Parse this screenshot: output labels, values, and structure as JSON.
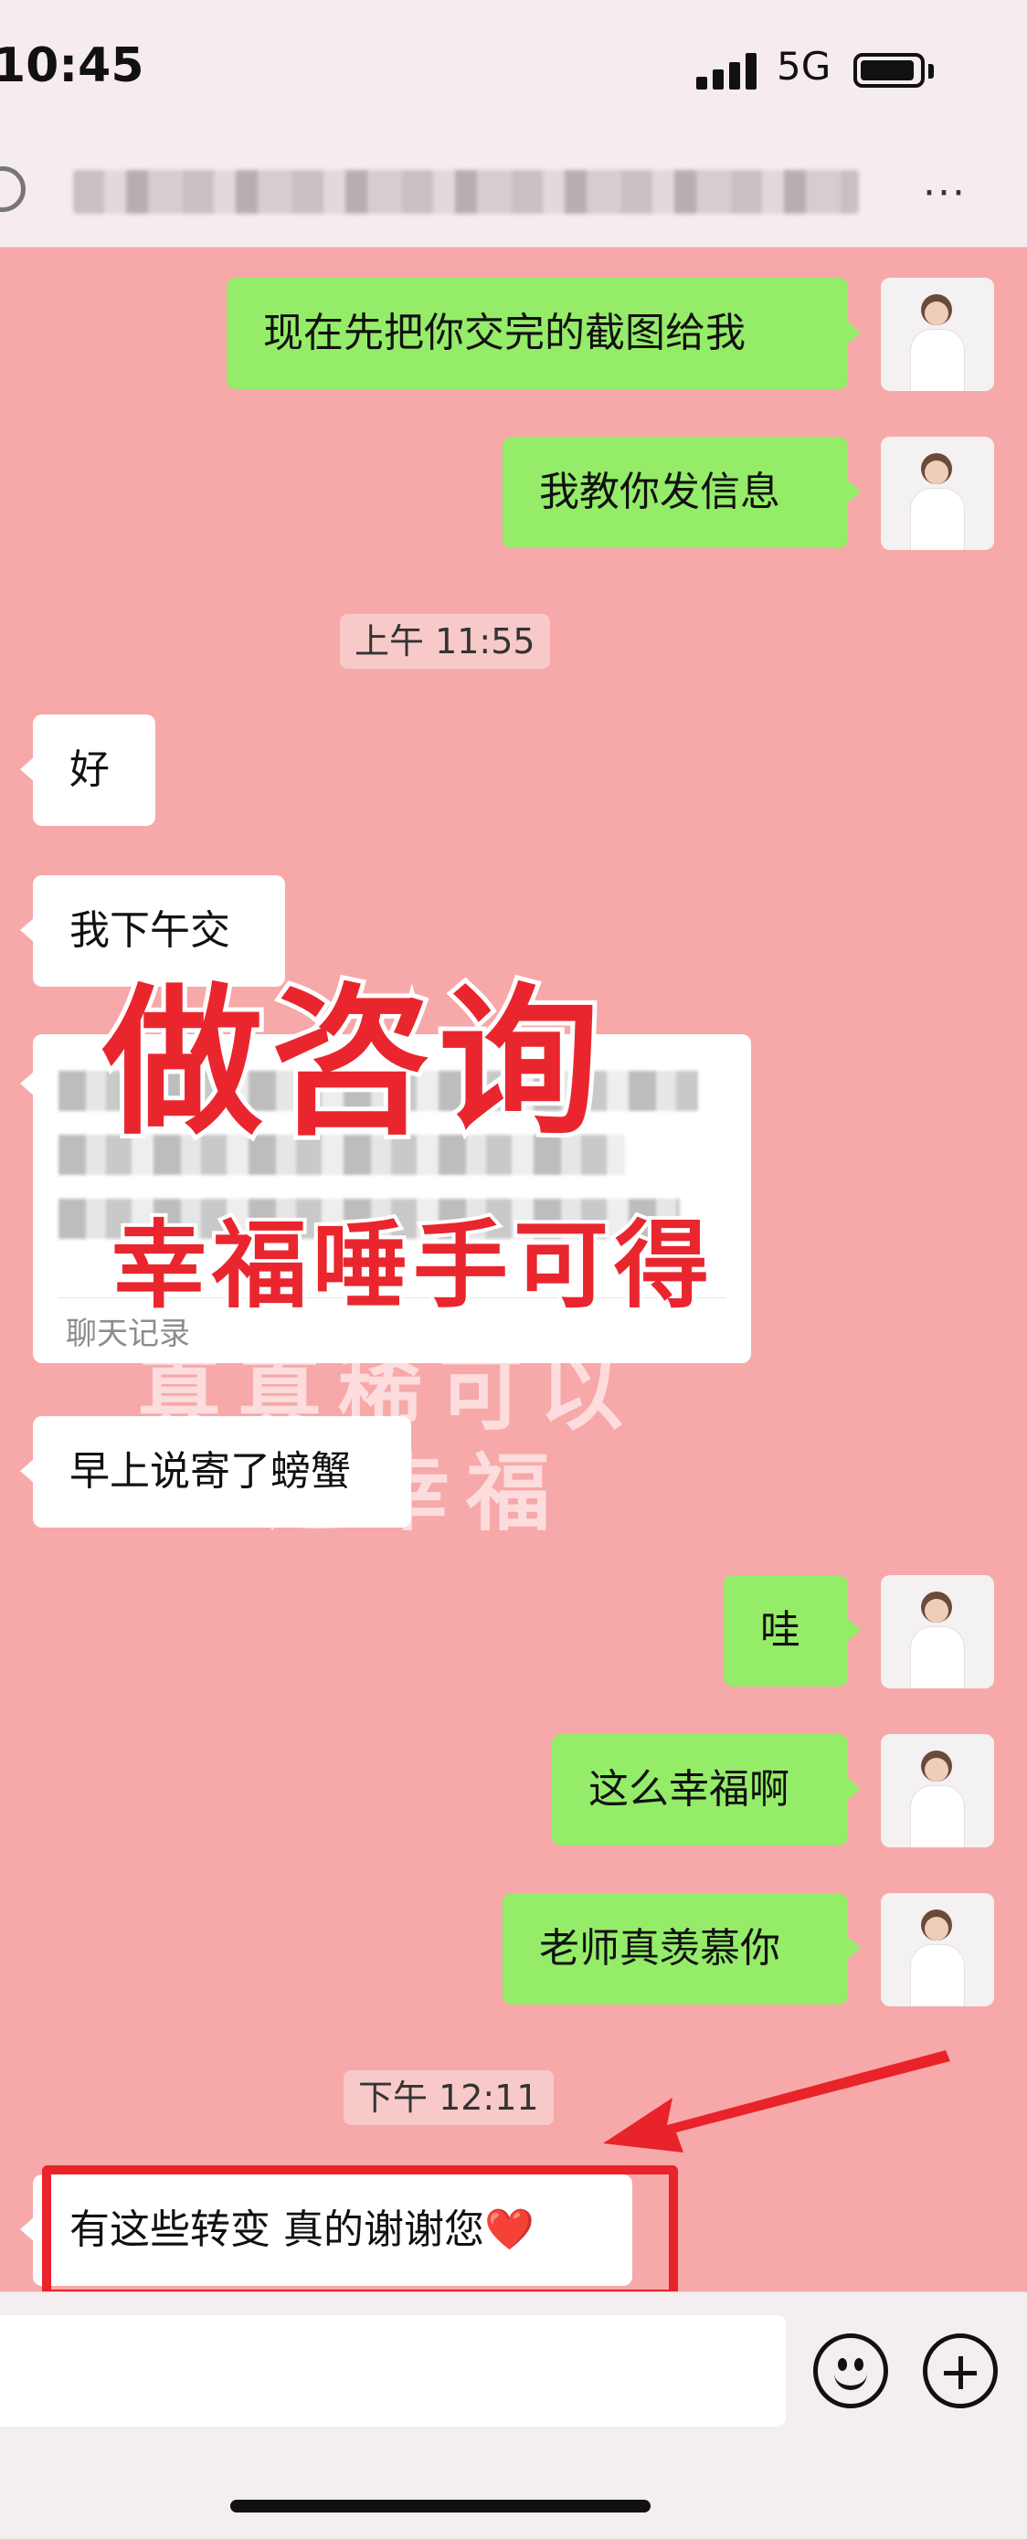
{
  "status_bar": {
    "time": "10:45",
    "network": "5G"
  },
  "nav": {
    "back_icon": "back-circle-icon",
    "more_icon": "more-dots-icon",
    "more_label": "···"
  },
  "messages": {
    "out1": "现在先把你交完的截图给我",
    "out2": "我教你发信息",
    "ts1": "上午 11:55",
    "in1": "好",
    "in2": "我下午交",
    "card_label": "聊天记录",
    "in3": "早上说寄了螃蟹",
    "out3": "哇",
    "out4": "这么幸福啊",
    "out5": "老师真羡慕你",
    "ts2": "下午 12:11",
    "in4": "有这些转变 真的谢谢您❤️"
  },
  "overlay": {
    "title": "做咨询",
    "subtitle": "幸福唾手可得",
    "ghost_line1": "真真稀可以",
    "ghost_line2": "这幸福"
  },
  "colors": {
    "background": "#f7a8a9",
    "outgoing_bubble": "#95ec69",
    "incoming_bubble": "#ffffff",
    "highlight_red": "#e8232a"
  },
  "bottom_bar": {
    "emoji_icon": "emoji-icon",
    "plus_icon": "plus-icon"
  }
}
